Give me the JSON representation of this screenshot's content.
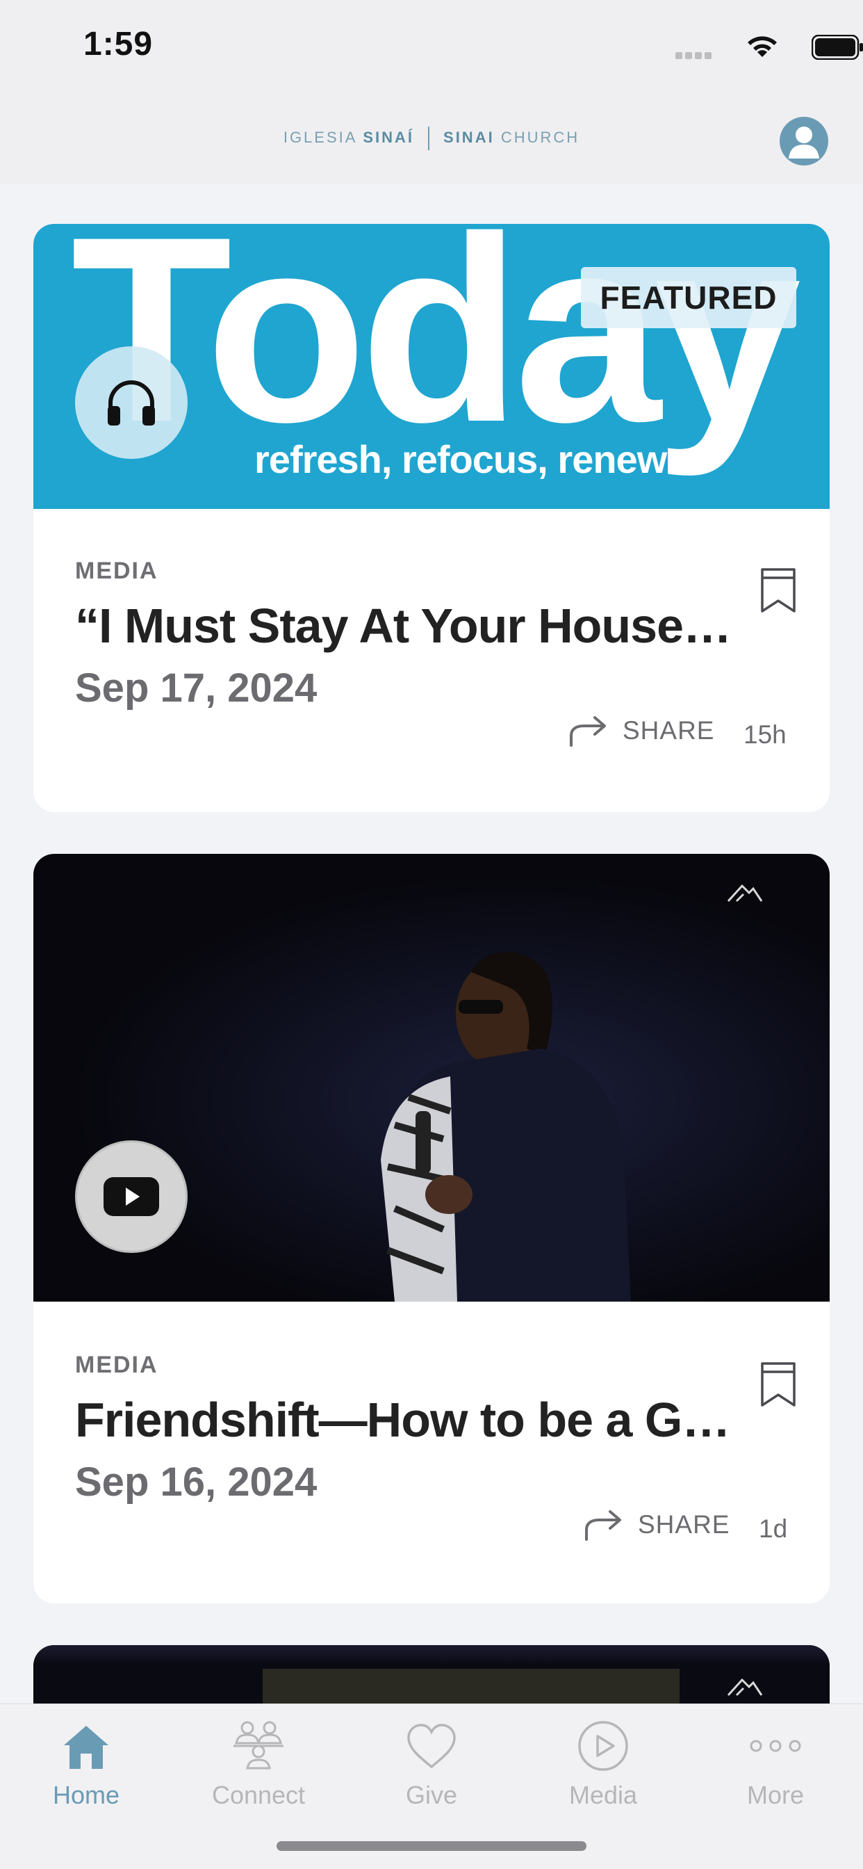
{
  "status_bar": {
    "time": "1:59"
  },
  "header": {
    "brand_left_light": "IGLESIA ",
    "brand_left_bold": "SINAÍ",
    "brand_right_bold": "SINAI",
    "brand_right_light": " CHURCH"
  },
  "cards": [
    {
      "hero_word": "Today",
      "hero_sub": "refresh, refocus, renew",
      "badge": "FEATURED",
      "media_icon": "headphones-icon",
      "category": "MEDIA",
      "title": "“I Must Stay At Your House…",
      "date": "Sep 17, 2024",
      "share_label": "SHARE",
      "age": "15h"
    },
    {
      "media_icon": "play-icon",
      "category": "MEDIA",
      "title": "Friendshift—How to be a G…",
      "date": "Sep 16, 2024",
      "share_label": "SHARE",
      "age": "1d"
    }
  ],
  "tabs": [
    {
      "label": "Home",
      "icon": "home-icon",
      "active": true
    },
    {
      "label": "Connect",
      "icon": "people-icon",
      "active": false
    },
    {
      "label": "Give",
      "icon": "heart-icon",
      "active": false
    },
    {
      "label": "Media",
      "icon": "play-circle-icon",
      "active": false
    },
    {
      "label": "More",
      "icon": "more-dots-icon",
      "active": false
    }
  ],
  "colors": {
    "accent": "#6a9bb4",
    "hero_blue": "#1fa5d0",
    "background": "#f2f3f7"
  }
}
